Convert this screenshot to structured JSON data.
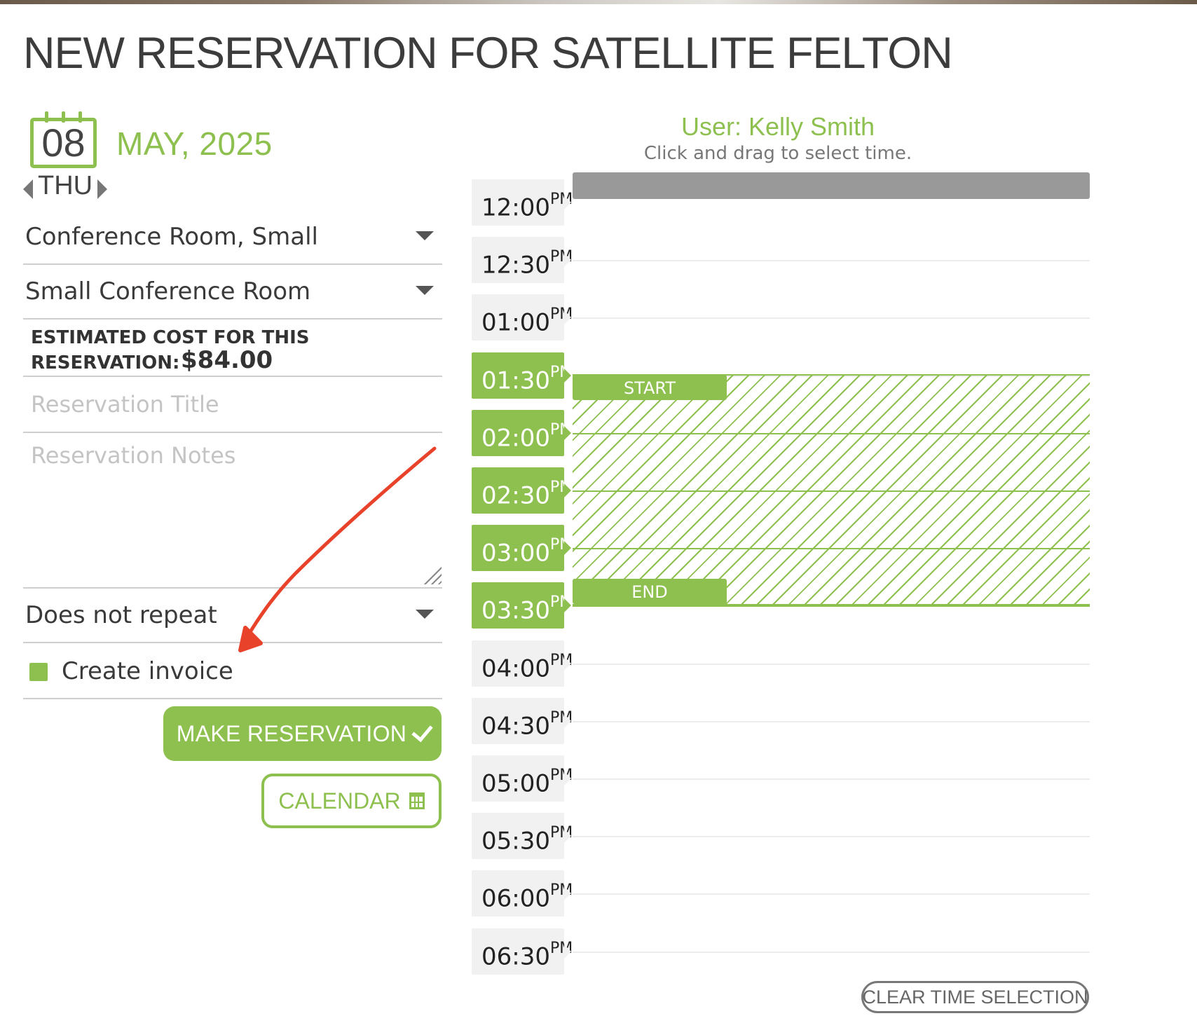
{
  "page": {
    "title": "NEW RESERVATION FOR SATELLITE FELTON"
  },
  "date": {
    "day": "08",
    "month_year": "MAY, 2025",
    "weekday": "THU"
  },
  "form": {
    "room_type": "Conference Room, Small",
    "room": "Small Conference Room",
    "cost_label": "ESTIMATED COST FOR THIS RESERVATION:",
    "cost_value": "$84.00",
    "title_placeholder": "Reservation Title",
    "notes_placeholder": "Reservation Notes",
    "repeat": "Does not repeat",
    "invoice_label": "Create invoice",
    "invoice_checked": true,
    "make_reservation_label": "MAKE RESERVATION",
    "calendar_label": "CALENDAR"
  },
  "schedule": {
    "user": "User: Kelly Smith",
    "hint": "Click and drag to select time.",
    "slots": [
      {
        "time": "12:00",
        "period": "PM",
        "selected": false
      },
      {
        "time": "12:30",
        "period": "PM",
        "selected": false
      },
      {
        "time": "01:00",
        "period": "PM",
        "selected": false
      },
      {
        "time": "01:30",
        "period": "PM",
        "selected": true
      },
      {
        "time": "02:00",
        "period": "PM",
        "selected": true
      },
      {
        "time": "02:30",
        "period": "PM",
        "selected": true
      },
      {
        "time": "03:00",
        "period": "PM",
        "selected": true
      },
      {
        "time": "03:30",
        "period": "PM",
        "selected": true
      },
      {
        "time": "04:00",
        "period": "PM",
        "selected": false
      },
      {
        "time": "04:30",
        "period": "PM",
        "selected": false
      },
      {
        "time": "05:00",
        "period": "PM",
        "selected": false
      },
      {
        "time": "05:30",
        "period": "PM",
        "selected": false
      },
      {
        "time": "06:00",
        "period": "PM",
        "selected": false
      },
      {
        "time": "06:30",
        "period": "PM",
        "selected": false
      }
    ],
    "start_label": "START",
    "end_label": "END",
    "clear_label": "CLEAR TIME SELECTION"
  },
  "colors": {
    "accent": "#8dc04f",
    "booked": "#999999",
    "annotation": "#e8432a"
  },
  "icons": {
    "date": "calendar-icon",
    "prev": "chevron-left-icon",
    "next": "chevron-right-icon",
    "dropdown": "caret-down-icon",
    "confirm": "check-icon",
    "calendar_button": "calendar-icon"
  }
}
